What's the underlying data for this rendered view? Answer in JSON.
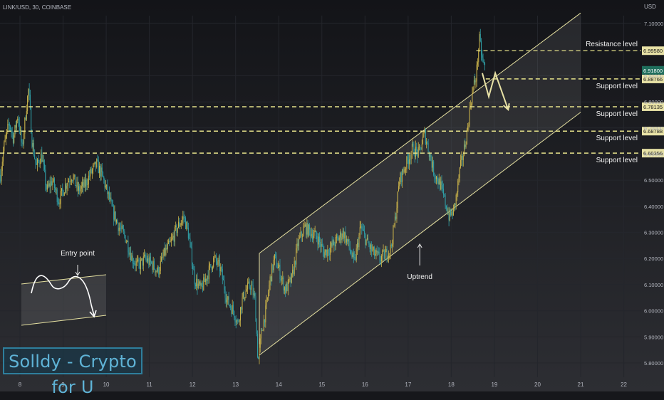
{
  "header": {
    "symbol": "LINK/USD, 30, COINBASE",
    "currency": "USD"
  },
  "watermark": "Solldy - Crypto for U",
  "colors": {
    "up": "#c9b24a",
    "down": "#2fa0a8",
    "channel": "#e5e0a0",
    "level_line": "#e6e28a",
    "text": "#f2f2f2",
    "axis_text": "#b2b5be"
  },
  "chart_data": {
    "type": "candlestick",
    "symbol": "LINK/USD",
    "timeframe": "30",
    "exchange": "COINBASE",
    "x_ticks": [
      "8",
      "9",
      "10",
      "11",
      "12",
      "13",
      "14",
      "15",
      "16",
      "17",
      "18",
      "19",
      "20",
      "21",
      "22"
    ],
    "y_ticks": [
      "7.10000",
      "6.90000",
      "6.80000",
      "6.70000",
      "6.60000",
      "6.50000",
      "6.40000",
      "6.30000",
      "6.20000",
      "6.10000",
      "6.00000",
      "5.90000",
      "5.80000"
    ],
    "ylim": [
      5.77,
      7.15
    ],
    "xlim": [
      7.55,
      22.2
    ],
    "current_price": {
      "label": "6.91800",
      "value": 6.918,
      "sub_label": "6.88766"
    },
    "price_path": [
      [
        7.55,
        6.52
      ],
      [
        7.62,
        6.62
      ],
      [
        7.75,
        6.72
      ],
      [
        7.85,
        6.66
      ],
      [
        7.95,
        6.75
      ],
      [
        8.05,
        6.62
      ],
      [
        8.15,
        6.78
      ],
      [
        8.2,
        6.85
      ],
      [
        8.28,
        6.65
      ],
      [
        8.38,
        6.55
      ],
      [
        8.5,
        6.6
      ],
      [
        8.62,
        6.46
      ],
      [
        8.75,
        6.5
      ],
      [
        8.9,
        6.42
      ],
      [
        9.05,
        6.48
      ],
      [
        9.2,
        6.52
      ],
      [
        9.35,
        6.46
      ],
      [
        9.5,
        6.48
      ],
      [
        9.65,
        6.53
      ],
      [
        9.78,
        6.56
      ],
      [
        9.9,
        6.52
      ],
      [
        10.05,
        6.44
      ],
      [
        10.15,
        6.38
      ],
      [
        10.3,
        6.32
      ],
      [
        10.45,
        6.28
      ],
      [
        10.6,
        6.2
      ],
      [
        10.75,
        6.17
      ],
      [
        10.9,
        6.2
      ],
      [
        11.05,
        6.18
      ],
      [
        11.2,
        6.15
      ],
      [
        11.35,
        6.22
      ],
      [
        11.5,
        6.26
      ],
      [
        11.65,
        6.32
      ],
      [
        11.8,
        6.36
      ],
      [
        11.9,
        6.3
      ],
      [
        12.05,
        6.12
      ],
      [
        12.2,
        6.08
      ],
      [
        12.35,
        6.14
      ],
      [
        12.5,
        6.2
      ],
      [
        12.65,
        6.16
      ],
      [
        12.8,
        6.04
      ],
      [
        12.95,
        6.0
      ],
      [
        13.05,
        5.95
      ],
      [
        13.15,
        6.04
      ],
      [
        13.25,
        6.08
      ],
      [
        13.35,
        6.1
      ],
      [
        13.45,
        6.04
      ],
      [
        13.52,
        5.8
      ],
      [
        13.6,
        5.92
      ],
      [
        13.7,
        6.0
      ],
      [
        13.8,
        6.12
      ],
      [
        13.9,
        6.2
      ],
      [
        14.0,
        6.16
      ],
      [
        14.15,
        6.08
      ],
      [
        14.3,
        6.12
      ],
      [
        14.45,
        6.26
      ],
      [
        14.6,
        6.32
      ],
      [
        14.75,
        6.3
      ],
      [
        14.9,
        6.28
      ],
      [
        15.05,
        6.22
      ],
      [
        15.2,
        6.24
      ],
      [
        15.35,
        6.27
      ],
      [
        15.5,
        6.3
      ],
      [
        15.62,
        6.25
      ],
      [
        15.75,
        6.18
      ],
      [
        15.9,
        6.32
      ],
      [
        16.05,
        6.26
      ],
      [
        16.2,
        6.22
      ],
      [
        16.35,
        6.2
      ],
      [
        16.5,
        6.22
      ],
      [
        16.6,
        6.24
      ],
      [
        16.7,
        6.35
      ],
      [
        16.8,
        6.5
      ],
      [
        16.95,
        6.56
      ],
      [
        17.1,
        6.62
      ],
      [
        17.25,
        6.6
      ],
      [
        17.38,
        6.68
      ],
      [
        17.5,
        6.6
      ],
      [
        17.6,
        6.53
      ],
      [
        17.75,
        6.48
      ],
      [
        17.85,
        6.42
      ],
      [
        17.95,
        6.36
      ],
      [
        18.05,
        6.38
      ],
      [
        18.12,
        6.44
      ],
      [
        18.2,
        6.54
      ],
      [
        18.3,
        6.62
      ],
      [
        18.38,
        6.7
      ],
      [
        18.45,
        6.8
      ],
      [
        18.52,
        6.86
      ],
      [
        18.58,
        6.9
      ],
      [
        18.65,
        7.04
      ],
      [
        18.72,
        6.96
      ],
      [
        18.8,
        6.92
      ]
    ],
    "levels": [
      {
        "label": "Resistance level",
        "value": 6.9958,
        "price_label": "6.99580"
      },
      {
        "label": "Support level",
        "value": 6.8876,
        "price_label": "6.88766"
      },
      {
        "label": "Support level",
        "value": 6.7813,
        "price_label": "6.78135"
      },
      {
        "label": "Support level",
        "value": 6.6878,
        "price_label": "6.68788"
      },
      {
        "label": "Support level",
        "value": 6.6035,
        "price_label": "6.60356"
      }
    ],
    "channel": {
      "lower": [
        [
          13.55,
          5.83
        ],
        [
          21.0,
          6.76
        ]
      ],
      "upper": [
        [
          13.55,
          6.22
        ],
        [
          21.0,
          7.14
        ]
      ]
    },
    "forecast_path": [
      [
        18.72,
        6.91
      ],
      [
        18.87,
        6.82
      ],
      [
        19.02,
        6.91
      ],
      [
        19.32,
        6.77
      ]
    ],
    "annotations": {
      "uptrend": "Uptrend",
      "entry_point": "Entry point"
    }
  }
}
